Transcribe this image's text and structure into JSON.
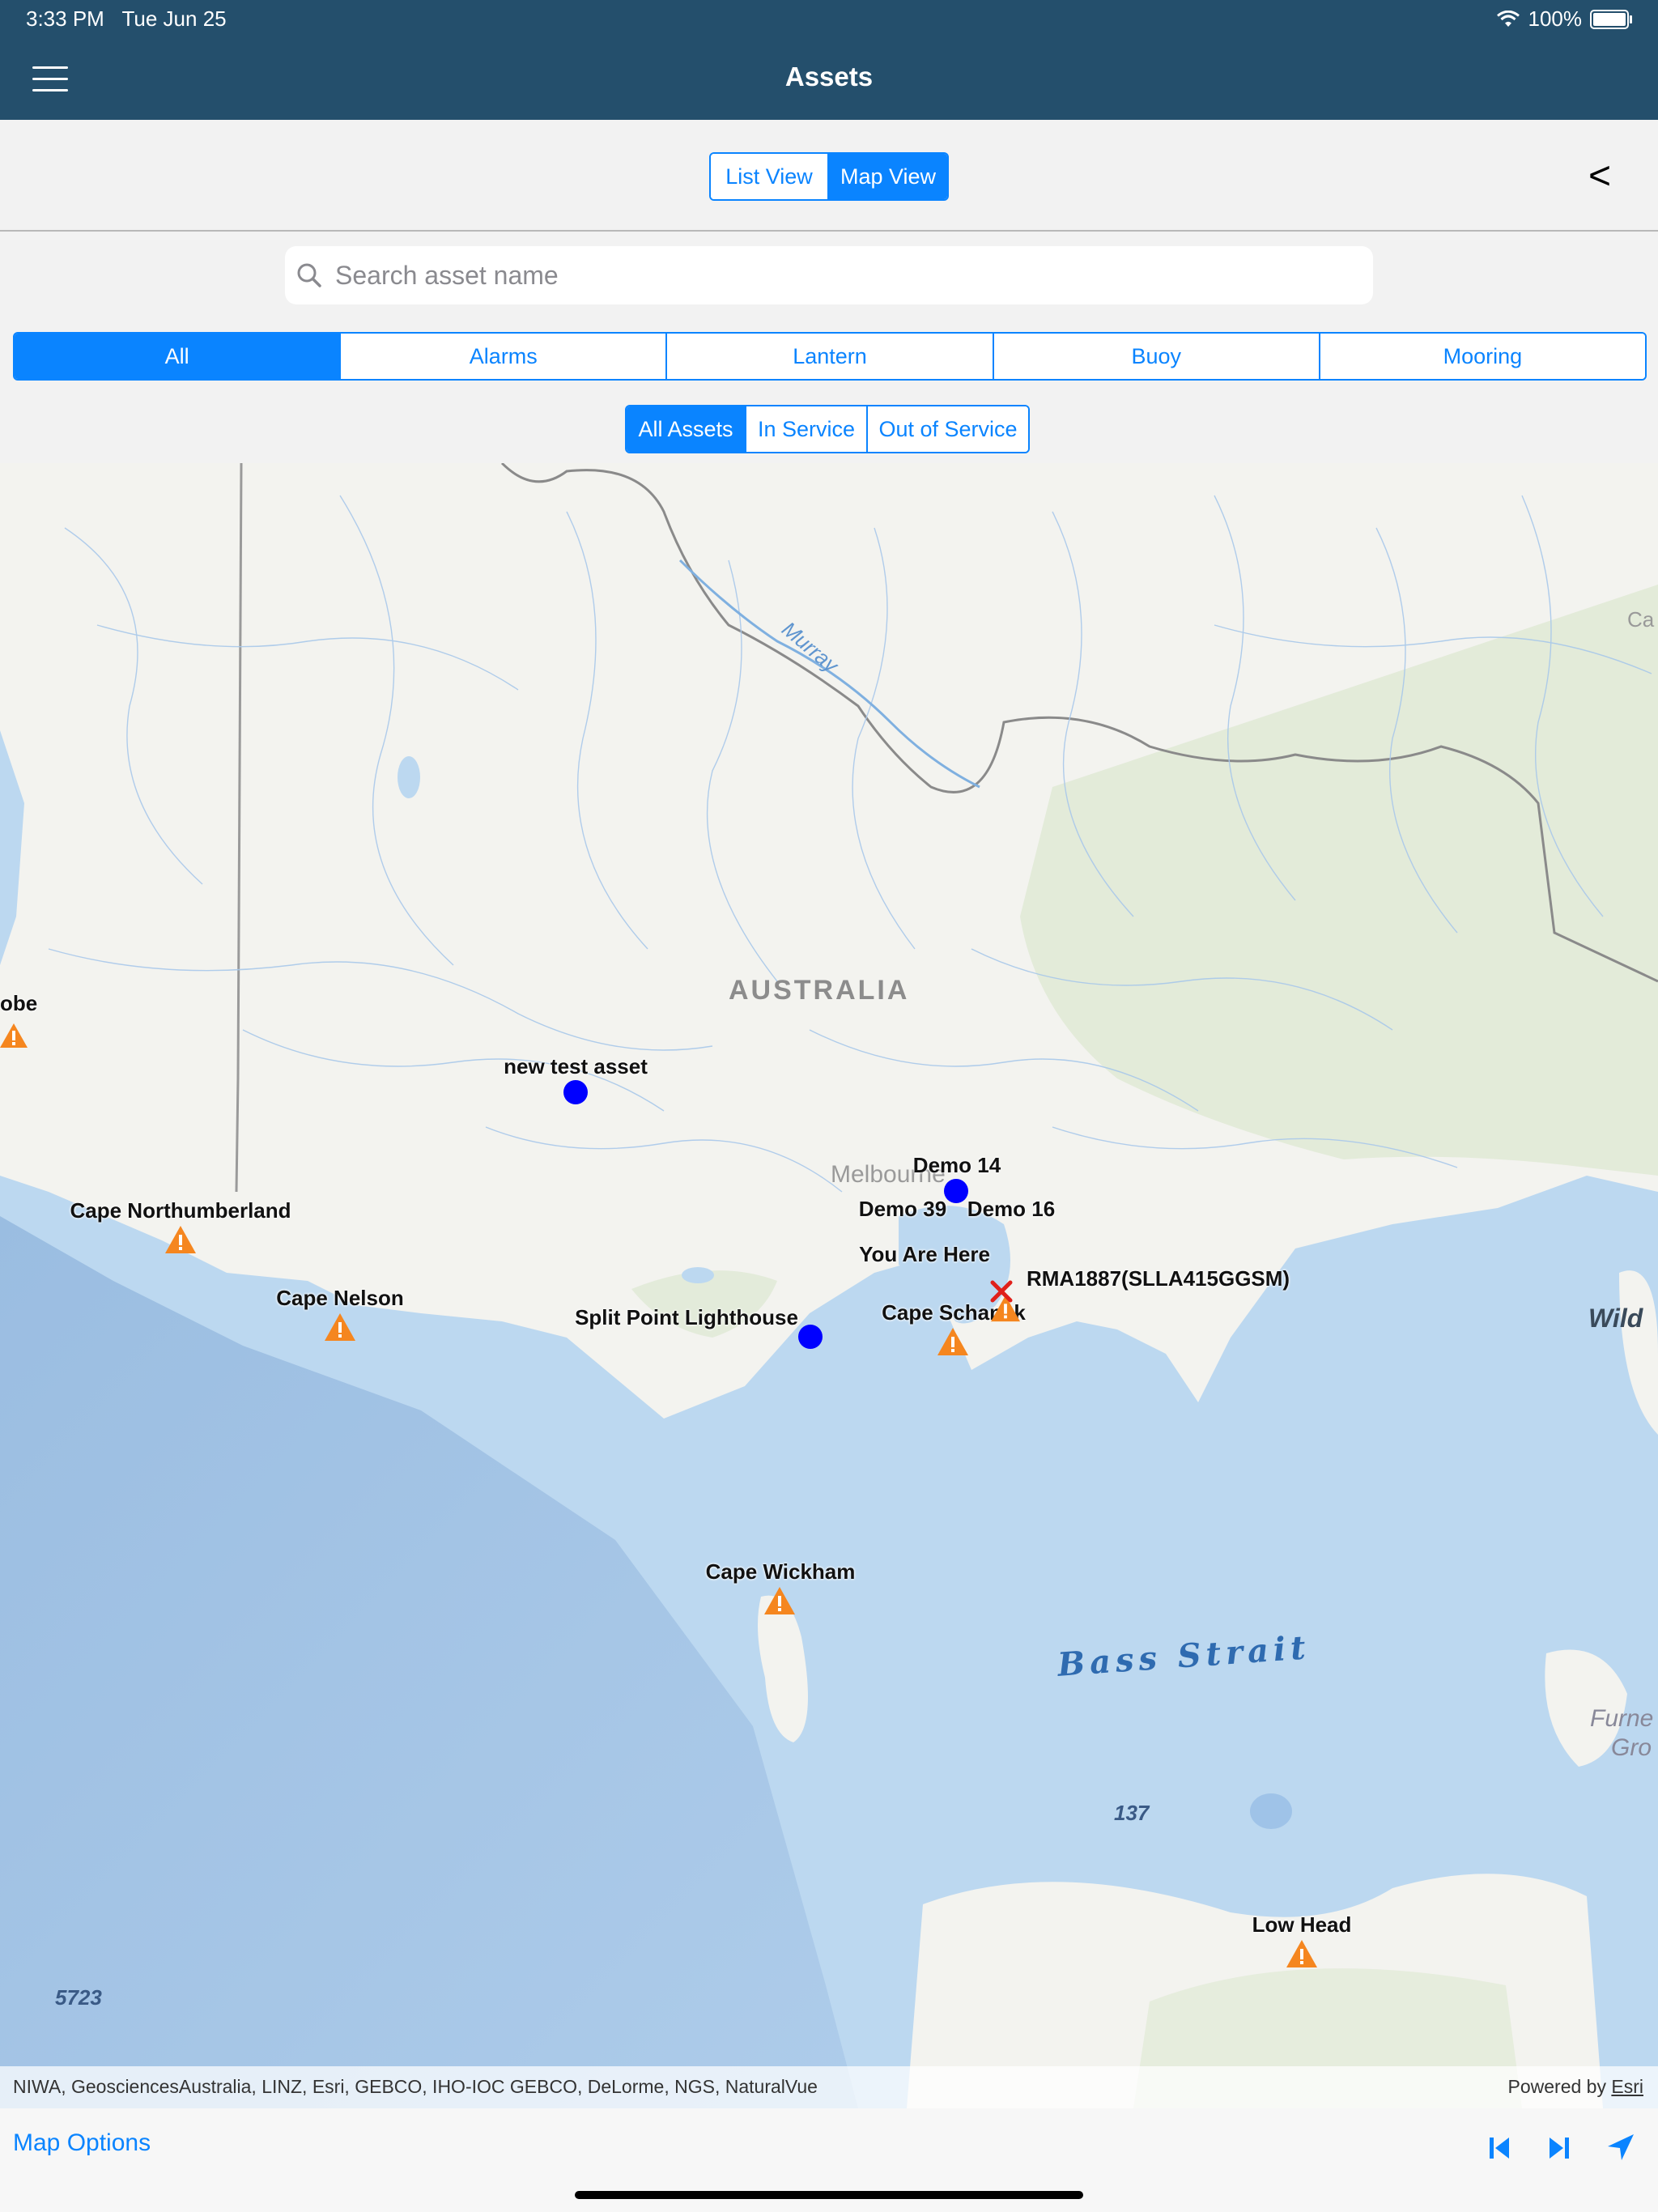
{
  "status_bar": {
    "time": "3:33 PM",
    "date": "Tue Jun 25",
    "battery": "100%",
    "battery_level": 1.0
  },
  "nav": {
    "title": "Assets",
    "menu_icon": "hamburger-menu-icon"
  },
  "view_toggle": {
    "options": [
      "List View",
      "Map View"
    ],
    "selected": "Map View",
    "back_label": "<"
  },
  "search": {
    "placeholder": "Search asset name",
    "value": "",
    "icon": "search-icon"
  },
  "category_tabs": {
    "options": [
      "All",
      "Alarms",
      "Lantern",
      "Buoy",
      "Mooring"
    ],
    "selected": "All"
  },
  "status_filter": {
    "options": [
      "All Assets",
      "In Service",
      "Out of Service"
    ],
    "selected": "All Assets"
  },
  "map": {
    "country_label": "AUSTRALIA",
    "city_label": "Melbourne",
    "river_label": "Murray",
    "sea_label": "Bass Strait",
    "depth_labels": [
      "137",
      "5723"
    ],
    "partial_labels": [
      "Ca",
      "Wild",
      "Furne",
      "Gro",
      "obe"
    ],
    "markers": [
      {
        "label": "new test asset",
        "type": "in-service-dot"
      },
      {
        "label": "Demo 14",
        "type": "in-service-dot"
      },
      {
        "label": "Demo 39",
        "type": "in-service-dot"
      },
      {
        "label": "Demo 16",
        "type": "in-service-dot"
      },
      {
        "label": "Split Point Lighthouse",
        "type": "in-service-dot"
      },
      {
        "label": "Cape Northumberland",
        "type": "alarm-warning"
      },
      {
        "label": "Cape Nelson",
        "type": "alarm-warning"
      },
      {
        "label": "Cape Schanck",
        "type": "alarm-warning"
      },
      {
        "label": "Cape Wickham",
        "type": "alarm-warning"
      },
      {
        "label": "Low Head",
        "type": "alarm-warning"
      },
      {
        "label": "RMA1887(SLLA415GGSM)",
        "type": "alarm-warning"
      },
      {
        "label": "You Are Here",
        "type": "current-location-cross"
      }
    ],
    "attribution": "NIWA, GeosciencesAustralia, LINZ, Esri, GEBCO, IHO-IOC GEBCO, DeLorme, NGS, NaturalVue",
    "powered_by": "Powered by",
    "powered_by_link": "Esri"
  },
  "bottom_bar": {
    "map_options_label": "Map Options",
    "icons": [
      "previous-icon",
      "next-icon",
      "locate-me-icon"
    ]
  },
  "colors": {
    "nav_bar": "#244f6c",
    "accent": "#0a84ff",
    "in_service_dot": "#0000ff",
    "alarm": "#f5861f",
    "water": "#b9d6ef",
    "land": "#f3f3ef"
  }
}
